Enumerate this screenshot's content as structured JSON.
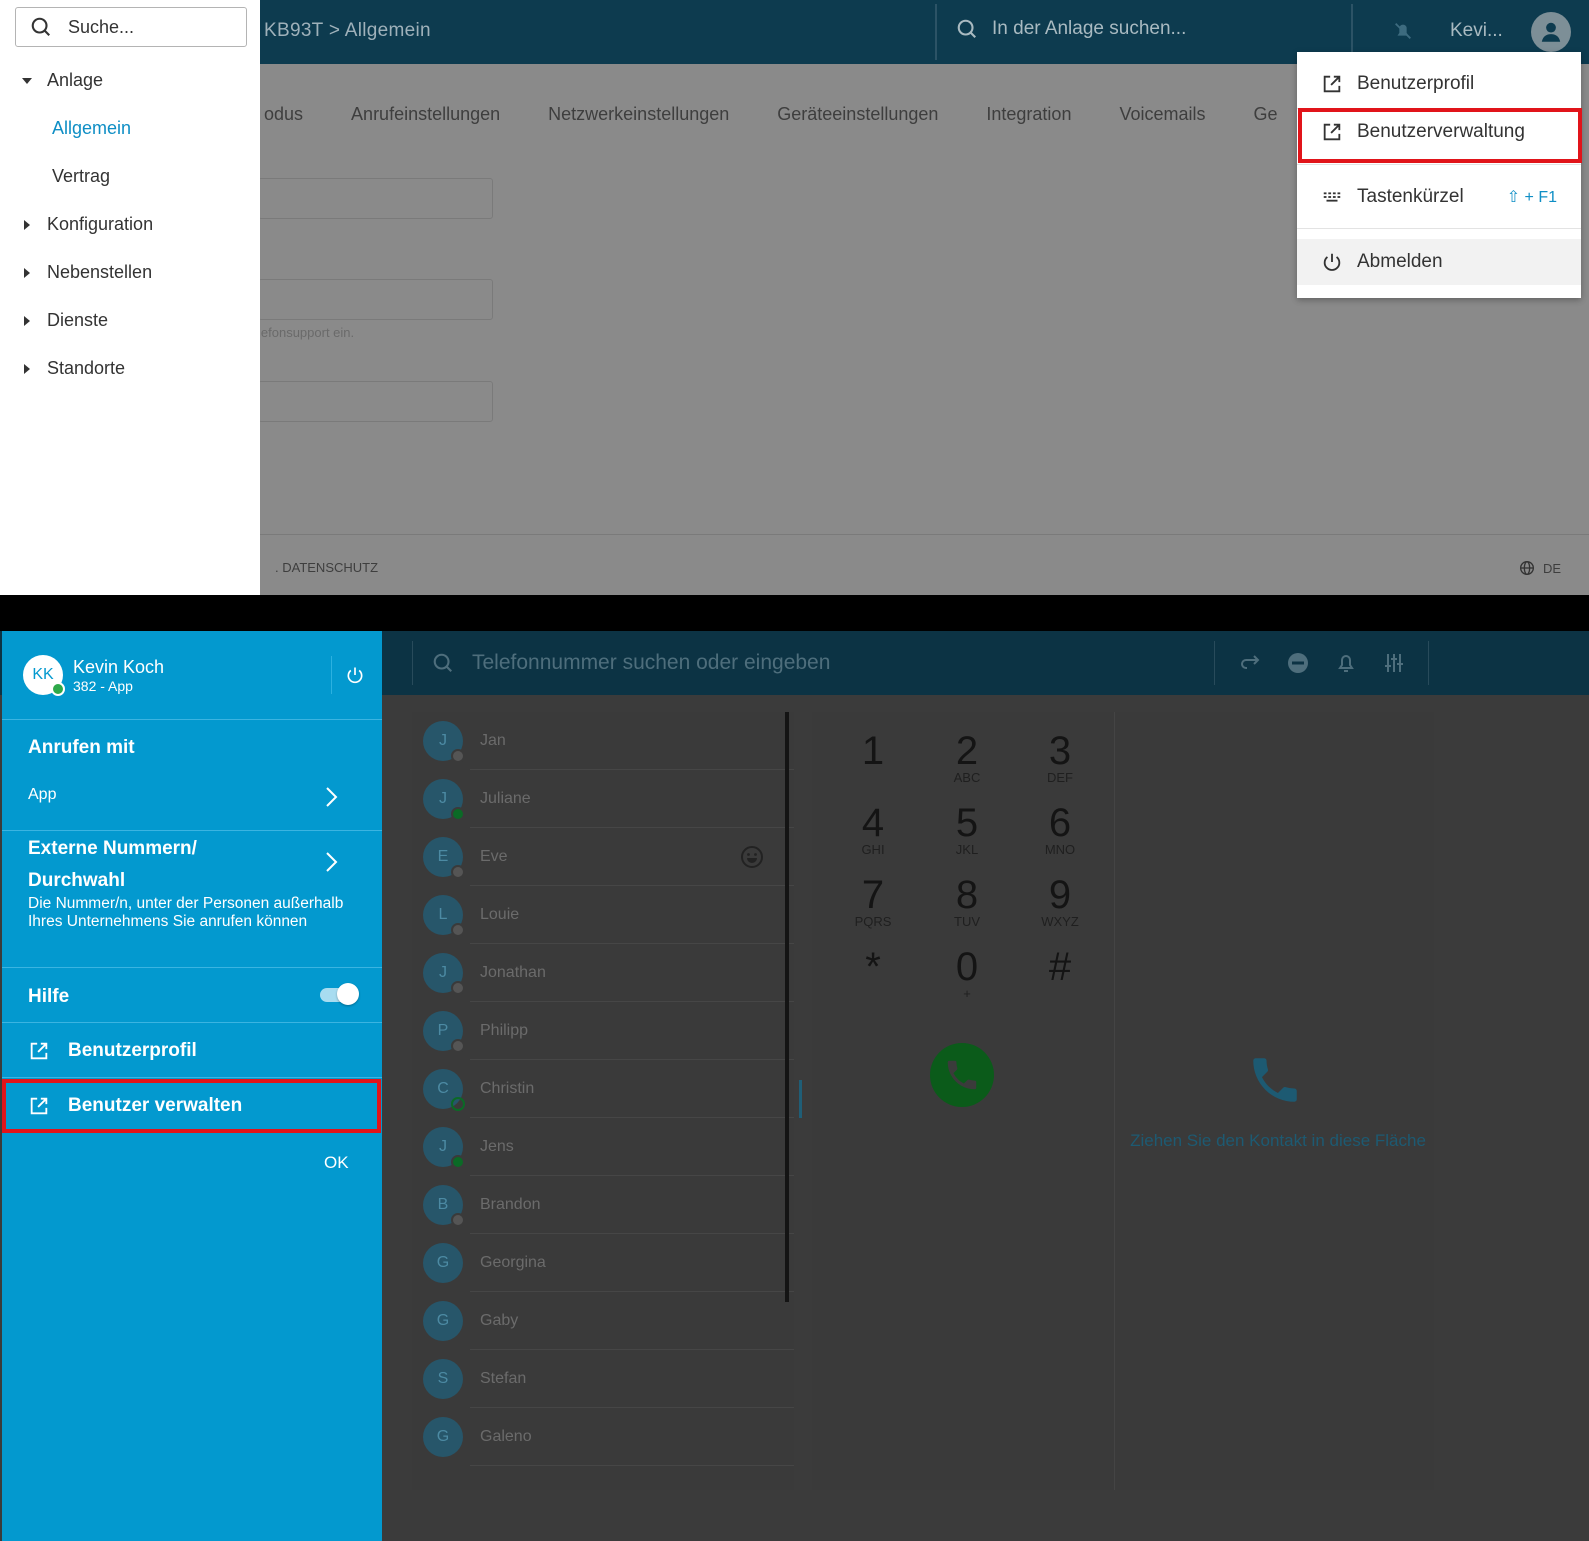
{
  "top": {
    "breadcrumb": "KB93T > Allgemein",
    "global_search_placeholder": "In der Anlage suchen...",
    "user_short": "Kevi...",
    "tabs": [
      "odus",
      "Anrufeinstellungen",
      "Netzwerkeinstellungen",
      "Geräteeinstellungen",
      "Integration",
      "Voicemails",
      "Ge"
    ],
    "field_hint": "lefonsupport ein.",
    "footer_link": ". DATENSCHUTZ",
    "language": "DE",
    "sidebar": {
      "search_placeholder": "Suche...",
      "items": [
        {
          "label": "Anlage",
          "expanded": true
        },
        {
          "label": "Allgemein",
          "active": true
        },
        {
          "label": "Vertrag"
        },
        {
          "label": "Konfiguration"
        },
        {
          "label": "Nebenstellen"
        },
        {
          "label": "Dienste"
        },
        {
          "label": "Standorte"
        }
      ]
    },
    "user_menu": {
      "items": [
        {
          "label": "Benutzerprofil",
          "icon": "external-link-icon"
        },
        {
          "label": "Benutzerverwaltung",
          "icon": "external-link-icon",
          "highlighted": true
        },
        {
          "label": "Tastenkürzel",
          "icon": "keyboard-icon",
          "shortcut": "⇧ + F1"
        },
        {
          "label": "Abmelden",
          "icon": "power-icon"
        }
      ]
    }
  },
  "bottom": {
    "search_placeholder": "Telefonnummer suchen oder eingeben",
    "user": {
      "initials": "KK",
      "name": "Kevin Koch",
      "subtitle": "382 - App"
    },
    "call_with": {
      "title": "Anrufen mit",
      "value": "App"
    },
    "external_numbers": {
      "title_line1": "Externe Nummern/",
      "title_line2": "Durchwahl",
      "description": "Die Nummer/n, unter der Personen außerhalb Ihres Unternehmens Sie anrufen können"
    },
    "help": {
      "label": "Hilfe",
      "enabled": true
    },
    "links": [
      {
        "label": "Benutzerprofil",
        "icon": "external-link-icon"
      },
      {
        "label": "Benutzer verwalten",
        "icon": "external-link-icon",
        "highlighted": true
      }
    ],
    "ok_label": "OK",
    "contacts": [
      {
        "initial": "J",
        "name": "Jan",
        "status": "offline"
      },
      {
        "initial": "J",
        "name": "Juliane",
        "status": "online"
      },
      {
        "initial": "E",
        "name": "Eve",
        "status": "offline",
        "emoji": true
      },
      {
        "initial": "L",
        "name": "Louie",
        "status": "offline"
      },
      {
        "initial": "J",
        "name": "Jonathan",
        "status": "offline"
      },
      {
        "initial": "P",
        "name": "Philipp",
        "status": "offline"
      },
      {
        "initial": "C",
        "name": "Christin",
        "status": "available"
      },
      {
        "initial": "J",
        "name": "Jens",
        "status": "online"
      },
      {
        "initial": "B",
        "name": "Brandon",
        "status": "offline"
      },
      {
        "initial": "G",
        "name": "Georgina",
        "status": "none"
      },
      {
        "initial": "G",
        "name": "Gaby",
        "status": "none"
      },
      {
        "initial": "S",
        "name": "Stefan",
        "status": "none"
      },
      {
        "initial": "G",
        "name": "Galeno",
        "status": "none"
      }
    ],
    "dialpad": [
      {
        "digit": "1",
        "letters": ""
      },
      {
        "digit": "2",
        "letters": "ABC"
      },
      {
        "digit": "3",
        "letters": "DEF"
      },
      {
        "digit": "4",
        "letters": "GHI"
      },
      {
        "digit": "5",
        "letters": "JKL"
      },
      {
        "digit": "6",
        "letters": "MNO"
      },
      {
        "digit": "7",
        "letters": "PQRS"
      },
      {
        "digit": "8",
        "letters": "TUV"
      },
      {
        "digit": "9",
        "letters": "WXYZ"
      },
      {
        "digit": "*",
        "letters": ""
      },
      {
        "digit": "0",
        "letters": "+"
      },
      {
        "digit": "#",
        "letters": ""
      }
    ],
    "drop_hint": "Ziehen Sie den Kontakt in diese Fläche"
  },
  "colors": {
    "accent": "#0399cf",
    "header_dark": "#0d3b4f",
    "highlight": "#e1141a",
    "link_blue": "#0e8ec5",
    "call_green": "#0b5b1a"
  }
}
